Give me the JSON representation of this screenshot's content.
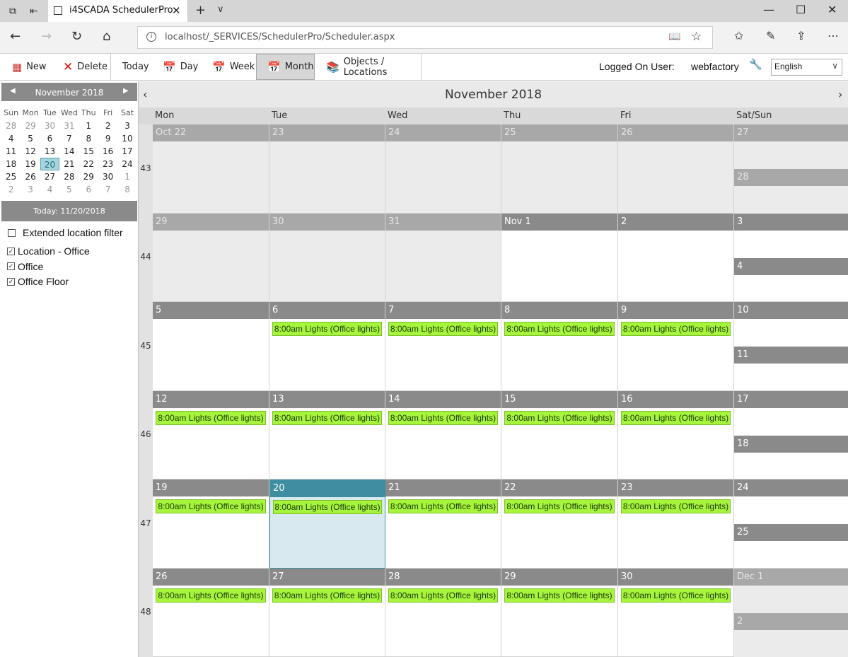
{
  "browser": {
    "tab_title": "i4SCADA SchedulerPro",
    "url": "localhost/_SERVICES/SchedulerPro/Scheduler.aspx"
  },
  "toolbar": {
    "new_label": "New",
    "delete_label": "Delete",
    "today_label": "Today",
    "day_label": "Day",
    "week_label": "Week",
    "month_label": "Month",
    "objects_label": "Objects / Locations",
    "logged_label": "Logged On User:",
    "user_name": "webfactory",
    "language": "English"
  },
  "mini_calendar": {
    "title": "November 2018",
    "weekdays": [
      "Sun",
      "Mon",
      "Tue",
      "Wed",
      "Thu",
      "Fri",
      "Sat"
    ],
    "weeks": [
      [
        "28",
        "29",
        "30",
        "31",
        "1",
        "2",
        "3"
      ],
      [
        "4",
        "5",
        "6",
        "7",
        "8",
        "9",
        "10"
      ],
      [
        "11",
        "12",
        "13",
        "14",
        "15",
        "16",
        "17"
      ],
      [
        "18",
        "19",
        "20",
        "21",
        "22",
        "23",
        "24"
      ],
      [
        "25",
        "26",
        "27",
        "28",
        "29",
        "30",
        "1"
      ],
      [
        "2",
        "3",
        "4",
        "5",
        "6",
        "7",
        "8"
      ]
    ],
    "selected": "20",
    "today_text": "Today: 11/20/2018"
  },
  "filters": {
    "extended_label": "Extended location filter",
    "items": [
      {
        "label": "Location - Office",
        "checked": true
      },
      {
        "label": "Office",
        "checked": true
      },
      {
        "label": "Office Floor",
        "checked": true
      }
    ]
  },
  "calendar": {
    "title": "November 2018",
    "day_headers": [
      "Mon",
      "Tue",
      "Wed",
      "Thu",
      "Fri",
      "Sat/Sun"
    ],
    "event_text": "8:00am Lights (Office lights)",
    "weeks": [
      {
        "num": "43",
        "days": [
          {
            "d": "Oct 22",
            "other": true,
            "ev": false
          },
          {
            "d": "23",
            "other": true,
            "ev": false
          },
          {
            "d": "24",
            "other": true,
            "ev": false
          },
          {
            "d": "25",
            "other": true,
            "ev": false
          },
          {
            "d": "26",
            "other": true,
            "ev": false
          }
        ],
        "sat": {
          "d": "27",
          "other": true
        },
        "sun": {
          "d": "28",
          "other": true
        }
      },
      {
        "num": "44",
        "days": [
          {
            "d": "29",
            "other": true,
            "ev": false
          },
          {
            "d": "30",
            "other": true,
            "ev": false
          },
          {
            "d": "31",
            "other": true,
            "ev": false
          },
          {
            "d": "Nov 1",
            "other": false,
            "ev": false
          },
          {
            "d": "2",
            "other": false,
            "ev": false
          }
        ],
        "sat": {
          "d": "3",
          "other": false
        },
        "sun": {
          "d": "4",
          "other": false
        }
      },
      {
        "num": "45",
        "days": [
          {
            "d": "5",
            "other": false,
            "ev": false
          },
          {
            "d": "6",
            "other": false,
            "ev": true
          },
          {
            "d": "7",
            "other": false,
            "ev": true
          },
          {
            "d": "8",
            "other": false,
            "ev": true
          },
          {
            "d": "9",
            "other": false,
            "ev": true
          }
        ],
        "sat": {
          "d": "10",
          "other": false
        },
        "sun": {
          "d": "11",
          "other": false
        }
      },
      {
        "num": "46",
        "days": [
          {
            "d": "12",
            "other": false,
            "ev": true
          },
          {
            "d": "13",
            "other": false,
            "ev": true
          },
          {
            "d": "14",
            "other": false,
            "ev": true
          },
          {
            "d": "15",
            "other": false,
            "ev": true
          },
          {
            "d": "16",
            "other": false,
            "ev": true
          }
        ],
        "sat": {
          "d": "17",
          "other": false
        },
        "sun": {
          "d": "18",
          "other": false
        }
      },
      {
        "num": "47",
        "days": [
          {
            "d": "19",
            "other": false,
            "ev": true
          },
          {
            "d": "20",
            "other": false,
            "ev": true,
            "sel": true
          },
          {
            "d": "21",
            "other": false,
            "ev": true
          },
          {
            "d": "22",
            "other": false,
            "ev": true
          },
          {
            "d": "23",
            "other": false,
            "ev": true
          }
        ],
        "sat": {
          "d": "24",
          "other": false
        },
        "sun": {
          "d": "25",
          "other": false
        }
      },
      {
        "num": "48",
        "days": [
          {
            "d": "26",
            "other": false,
            "ev": true
          },
          {
            "d": "27",
            "other": false,
            "ev": true
          },
          {
            "d": "28",
            "other": false,
            "ev": true
          },
          {
            "d": "29",
            "other": false,
            "ev": true
          },
          {
            "d": "30",
            "other": false,
            "ev": true
          }
        ],
        "sat": {
          "d": "Dec 1",
          "other": true
        },
        "sun": {
          "d": "2",
          "other": true
        }
      }
    ]
  }
}
